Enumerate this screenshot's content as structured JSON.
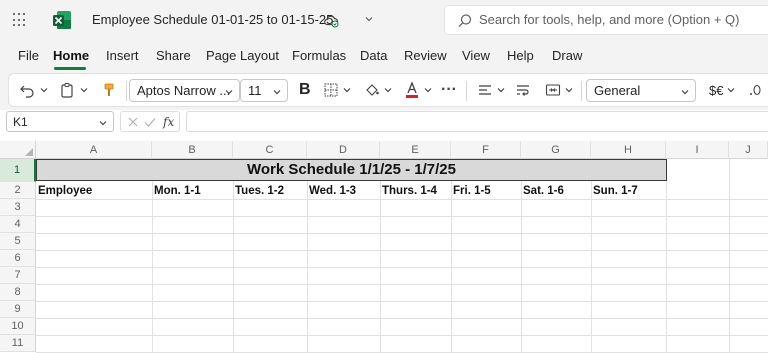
{
  "window": {
    "doc_title": "Employee Schedule 01-01-25 to 01-15-25",
    "search_placeholder": "Search for tools, help, and more (Option + Q)",
    "brand_color": "#107c41"
  },
  "menu": {
    "items": [
      "File",
      "Home",
      "Insert",
      "Share",
      "Page Layout",
      "Formulas",
      "Data",
      "Review",
      "View",
      "Help",
      "Draw"
    ],
    "active": "Home"
  },
  "ribbon": {
    "font_name": "Aptos Narrow ...",
    "font_size": "11",
    "bold_label": "B",
    "more_label": "···",
    "number_format": "General",
    "currency_label": "$€",
    "font_color": "#e01e1e",
    "icons": [
      "undo-icon",
      "clipboard-icon",
      "format-painter-icon",
      "borders-icon",
      "fill-color-icon",
      "font-color-icon",
      "align-icon",
      "wrap-text-icon",
      "merge-icon",
      "decimal-icon"
    ]
  },
  "formula_bar": {
    "name_box": "K1",
    "fx_label": "fx",
    "formula": ""
  },
  "sheet": {
    "columns": [
      "A",
      "B",
      "C",
      "D",
      "E",
      "F",
      "G",
      "H",
      "I",
      "J"
    ],
    "rows": [
      "1",
      "2",
      "3",
      "4",
      "5",
      "6",
      "7",
      "8",
      "9",
      "10",
      "11"
    ],
    "selected_row": "1",
    "title": "Work Schedule 1/1/25 - 1/7/25",
    "headers": [
      "Employee",
      "Mon. 1-1",
      "Tues. 1-2",
      "Wed. 1-3",
      "Thurs. 1-4",
      "Fri. 1-5",
      "Sat. 1-6",
      "Sun. 1-7"
    ],
    "title_fill": "#d9d9d9"
  }
}
